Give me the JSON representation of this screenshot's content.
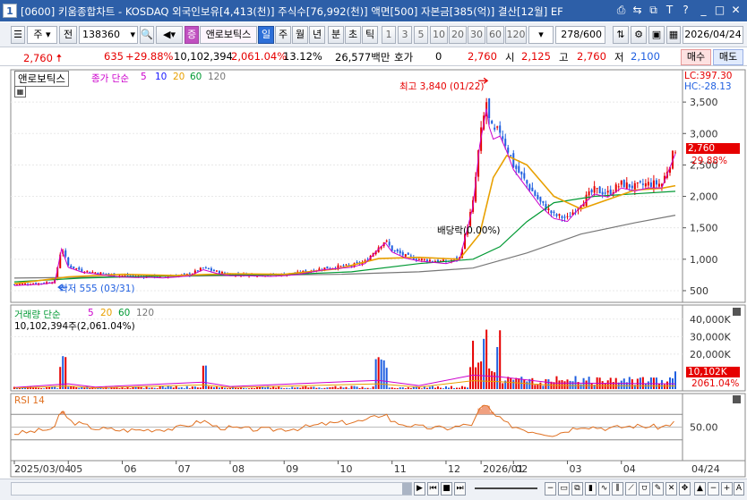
{
  "window": {
    "app_icon": "1",
    "title": "[0600] 키움종합차트 - KOSDAQ 외국인보유[4,413(천)] 주식수[76,992(천)] 액면[500] 자본금[385(억)] 결산[12월] EF",
    "buttons": [
      "⎙",
      "⇆",
      "⧉",
      "T",
      "?",
      "_",
      "□",
      "✕"
    ]
  },
  "toolbar": {
    "type_select": "주",
    "all_button": "전",
    "code": "138360",
    "sound_icon": "speaker-icon",
    "jeung_badge": "증",
    "stock_name": "앤로보틱스",
    "periods": [
      "일",
      "주",
      "월",
      "년",
      "분",
      "초",
      "틱"
    ],
    "active_period": "일",
    "numbers": [
      "1",
      "3",
      "5",
      "10",
      "20",
      "30",
      "60",
      "120"
    ],
    "count": "278/600",
    "date": "2026/04/24"
  },
  "info_row": {
    "price": "2,760",
    "change": "635",
    "change_pct": "+29.88%",
    "volume": "10,102,394",
    "vol_pct": "2,061.04%",
    "turnover": "13.12%",
    "amount": "26,577백만",
    "hoga_label": "호가",
    "hoga_value": "0",
    "hoga_price": "2,760",
    "open_label": "시",
    "open": "2,125",
    "high_label": "고",
    "high": "2,760",
    "low_label": "저",
    "low": "2,100",
    "buy_button": "매수",
    "sell_button": "매도"
  },
  "price_panel": {
    "name_tag": "앤로보틱스",
    "legend_label": "종가 단순",
    "ma_periods": [
      "5",
      "10",
      "20",
      "60",
      "120"
    ],
    "ma_colors": [
      "#cc00cc",
      "#1a1aff",
      "#e8a000",
      "#009933",
      "#777777"
    ],
    "lc": "LC:397.30",
    "hc": "HC:-28.13",
    "high_annotation": "최고 3,840 (01/22)",
    "low_annotation": "최저 555 (03/31)",
    "dividend_annotation": "배당락(0.00%)",
    "current_price_tag": "2,760",
    "current_pct_tag": "29.88%",
    "y_ticks": [
      "3,500",
      "3,000",
      "2,500",
      "2,000",
      "1,500",
      "1,000",
      "500"
    ]
  },
  "volume_panel": {
    "legend_label": "거래량 단순",
    "ma_periods": [
      "5",
      "20",
      "60",
      "120"
    ],
    "ma_colors": [
      "#cc00cc",
      "#e8a000",
      "#009933",
      "#777777"
    ],
    "volume_text": "10,102,394주(2,061.04%)",
    "current_tag": "10,102K",
    "current_pct": "2061.04%",
    "y_ticks": [
      "40,000K",
      "30,000K",
      "20,000K"
    ]
  },
  "rsi_panel": {
    "legend_label": "RSI 14",
    "y_ticks": [
      "50.00"
    ]
  },
  "x_axis": {
    "labels": [
      "2025/03/04",
      "05",
      "06",
      "07",
      "08",
      "09",
      "10",
      "11",
      "12",
      "2026/01",
      "02",
      "03",
      "04"
    ],
    "end_label": "04/24"
  },
  "colors": {
    "up": "#e60000",
    "down": "#1f5fe0",
    "titlebar": "#2d5fa8",
    "rsi_line": "#e07020",
    "rsi_fill": "#f0a080"
  },
  "chart_data": {
    "type": "candlestick",
    "y_range": [
      400,
      3900
    ],
    "volume_range_k": [
      0,
      45000
    ],
    "rsi_range": [
      0,
      100
    ],
    "rsi_reference": [
      70,
      50,
      30
    ],
    "close_series": [
      [
        0,
        600
      ],
      [
        10,
        610
      ],
      [
        20,
        620
      ],
      [
        30,
        650
      ],
      [
        35,
        1200
      ],
      [
        40,
        900
      ],
      [
        50,
        820
      ],
      [
        60,
        790
      ],
      [
        70,
        760
      ],
      [
        80,
        740
      ],
      [
        90,
        730
      ],
      [
        100,
        735
      ],
      [
        110,
        725
      ],
      [
        120,
        740
      ],
      [
        130,
        760
      ],
      [
        140,
        860
      ],
      [
        150,
        800
      ],
      [
        160,
        760
      ],
      [
        170,
        760
      ],
      [
        180,
        755
      ],
      [
        190,
        750
      ],
      [
        200,
        760
      ],
      [
        210,
        780
      ],
      [
        220,
        820
      ],
      [
        230,
        860
      ],
      [
        240,
        880
      ],
      [
        250,
        900
      ],
      [
        260,
        960
      ],
      [
        270,
        1200
      ],
      [
        275,
        1300
      ],
      [
        280,
        1150
      ],
      [
        290,
        1050
      ],
      [
        300,
        1000
      ],
      [
        310,
        980
      ],
      [
        320,
        960
      ],
      [
        330,
        1020
      ],
      [
        340,
        1900
      ],
      [
        345,
        2900
      ],
      [
        350,
        3500
      ],
      [
        352,
        3200
      ],
      [
        355,
        3000
      ],
      [
        360,
        3050
      ],
      [
        365,
        2800
      ],
      [
        370,
        2500
      ],
      [
        380,
        2200
      ],
      [
        390,
        1900
      ],
      [
        400,
        1700
      ],
      [
        410,
        1650
      ],
      [
        420,
        1900
      ],
      [
        430,
        2100
      ],
      [
        440,
        2050
      ],
      [
        450,
        2200
      ],
      [
        460,
        2150
      ],
      [
        470,
        2200
      ],
      [
        480,
        2200
      ],
      [
        490,
        2760
      ]
    ],
    "ma20_series": [
      [
        0,
        610
      ],
      [
        40,
        720
      ],
      [
        80,
        760
      ],
      [
        120,
        740
      ],
      [
        160,
        770
      ],
      [
        200,
        760
      ],
      [
        240,
        850
      ],
      [
        270,
        1010
      ],
      [
        300,
        1030
      ],
      [
        330,
        1000
      ],
      [
        345,
        1400
      ],
      [
        355,
        2300
      ],
      [
        365,
        2650
      ],
      [
        380,
        2500
      ],
      [
        400,
        2000
      ],
      [
        420,
        1800
      ],
      [
        440,
        1950
      ],
      [
        460,
        2100
      ],
      [
        480,
        2130
      ],
      [
        490,
        2170
      ]
    ],
    "ma60_series": [
      [
        0,
        640
      ],
      [
        50,
        700
      ],
      [
        100,
        730
      ],
      [
        150,
        750
      ],
      [
        200,
        755
      ],
      [
        250,
        800
      ],
      [
        300,
        930
      ],
      [
        340,
        1000
      ],
      [
        360,
        1200
      ],
      [
        380,
        1600
      ],
      [
        400,
        1900
      ],
      [
        430,
        2000
      ],
      [
        460,
        2040
      ],
      [
        490,
        2080
      ]
    ],
    "ma120_series": [
      [
        0,
        700
      ],
      [
        80,
        720
      ],
      [
        160,
        740
      ],
      [
        240,
        760
      ],
      [
        300,
        800
      ],
      [
        340,
        860
      ],
      [
        380,
        1100
      ],
      [
        420,
        1400
      ],
      [
        460,
        1580
      ],
      [
        490,
        1700
      ]
    ],
    "high_point": {
      "x": 352,
      "y": 3840
    },
    "low_point": {
      "x": 30,
      "y": 555
    },
    "rsi_series": [
      [
        0,
        40
      ],
      [
        10,
        42
      ],
      [
        20,
        45
      ],
      [
        30,
        48
      ],
      [
        35,
        80
      ],
      [
        40,
        60
      ],
      [
        60,
        48
      ],
      [
        80,
        45
      ],
      [
        100,
        46
      ],
      [
        120,
        48
      ],
      [
        140,
        60
      ],
      [
        150,
        50
      ],
      [
        170,
        47
      ],
      [
        190,
        46
      ],
      [
        210,
        48
      ],
      [
        230,
        55
      ],
      [
        250,
        58
      ],
      [
        260,
        60
      ],
      [
        270,
        68
      ],
      [
        275,
        72
      ],
      [
        280,
        58
      ],
      [
        300,
        50
      ],
      [
        320,
        48
      ],
      [
        340,
        55
      ],
      [
        345,
        78
      ],
      [
        350,
        85
      ],
      [
        355,
        70
      ],
      [
        365,
        55
      ],
      [
        380,
        45
      ],
      [
        400,
        38
      ],
      [
        420,
        52
      ],
      [
        440,
        48
      ],
      [
        460,
        52
      ],
      [
        480,
        50
      ],
      [
        490,
        58
      ]
    ]
  }
}
